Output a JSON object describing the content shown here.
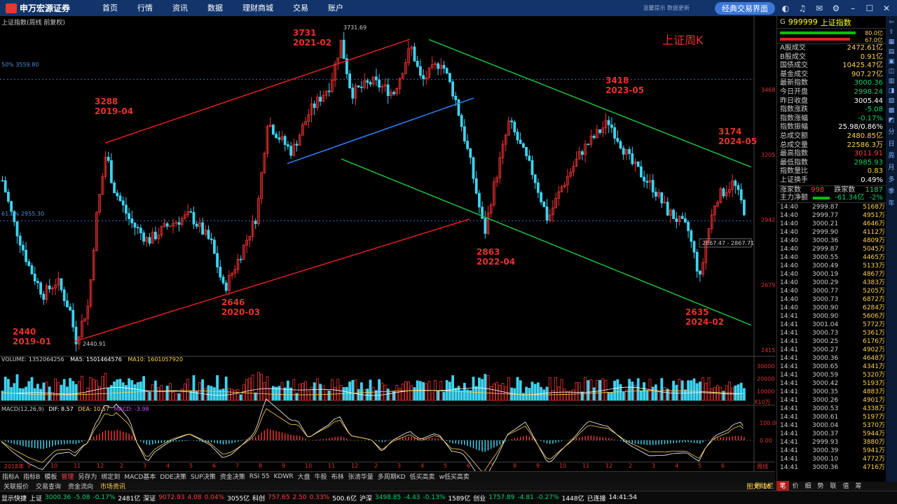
{
  "topbar": {
    "logo": "申万宏源证券",
    "nav": [
      "首页",
      "行情",
      "资讯",
      "数据",
      "理财商城",
      "交易",
      "账户"
    ],
    "faint": "温馨提示 数据更新",
    "classic_btn": "经典交易界面"
  },
  "chart": {
    "title": "上证指数(周线 前复权)",
    "big_title": "上证周K",
    "price_labels": [
      "3731.69",
      "2440.91",
      "2867.47 - 2867.71"
    ],
    "fib_labels": [
      "50% 3559.80",
      "61.8% 2955.30"
    ],
    "axis_prices": [
      "3468",
      "3205",
      "2942",
      "2679",
      "2415"
    ],
    "annotations": [
      {
        "price": "3731",
        "date": "2021-02"
      },
      {
        "price": "3288",
        "date": "2019-04"
      },
      {
        "price": "3418",
        "date": "2023-05"
      },
      {
        "price": "3174",
        "date": "2024-05"
      },
      {
        "price": "2440",
        "date": "2019-01"
      },
      {
        "price": "2646",
        "date": "2020-03"
      },
      {
        "price": "2863",
        "date": "2022-04"
      },
      {
        "price": "2635",
        "date": "2024-02"
      }
    ],
    "volume_label": "VOLUME: 1352064256",
    "ma5_label": "MA5: 1501464576",
    "ma10_label": "MA10: 1601057920",
    "vol_axis": [
      "30000",
      "20000",
      "10000",
      "X10万"
    ],
    "macd_label": "MACD(12,26,9)",
    "dif_label": "DIF: 8.57",
    "dea_label": "DEA: 10.57",
    "macd_val": "MACD: -3.98",
    "macd_axis": [
      "100.00",
      "0.00"
    ],
    "x_axis": [
      "2018年",
      "9",
      "10",
      "11",
      "12",
      "2",
      "3",
      "4",
      "5",
      "6",
      "7",
      "8",
      "9",
      "10",
      "11",
      "12",
      "2",
      "3",
      "4",
      "5",
      "6",
      "7",
      "8",
      "9",
      "10",
      "11",
      "12",
      "2",
      "3",
      "4",
      "5",
      "6",
      "周线"
    ]
  },
  "tabs": [
    "指标A",
    "指标B",
    "模板",
    "管理",
    "另存为",
    "绑定到",
    "MACD基本",
    "DDE决策",
    "SUP决策",
    "资金决策",
    "RSI 55",
    "KDWR",
    "大盘",
    "牛股",
    "布林",
    "张清华量",
    "多周期KD",
    "低买高卖",
    "w低买高卖"
  ],
  "subtabs": [
    "关联报价",
    "交易查询",
    "资金流向",
    "市场资讯"
  ],
  "subtabs_right": [
    "图文F10",
    "刷边栏"
  ],
  "rpanel": {
    "g": "G",
    "code": "999999",
    "name": "上证指数",
    "bar_top": "80.0亿",
    "bar_bot": "67.0亿",
    "stats": [
      {
        "k": "A股成交",
        "v": "2472.61亿",
        "c": "yl"
      },
      {
        "k": "B股成交",
        "v": "0.91亿",
        "c": "yl"
      },
      {
        "k": "国债成交",
        "v": "10425.47亿",
        "c": "yl"
      },
      {
        "k": "基金成交",
        "v": "907.27亿",
        "c": "yl"
      },
      {
        "k": "最新指数",
        "v": "3000.36",
        "c": "dn"
      },
      {
        "k": "今日开盘",
        "v": "2998.24",
        "c": "dn"
      },
      {
        "k": "昨日收盘",
        "v": "3005.44",
        "c": "wh"
      },
      {
        "k": "指数涨跌",
        "v": "-5.08",
        "c": "dn"
      },
      {
        "k": "指数涨幅",
        "v": "-0.17%",
        "c": "dn"
      },
      {
        "k": "指数振幅",
        "v": "25.98/0.86%",
        "c": "wh"
      },
      {
        "k": "总成交额",
        "v": "2480.85亿",
        "c": "yl"
      },
      {
        "k": "总成交量",
        "v": "22586.3万",
        "c": "yl"
      },
      {
        "k": "最高指数",
        "v": "3011.91",
        "c": "up"
      },
      {
        "k": "最低指数",
        "v": "2985.93",
        "c": "dn"
      },
      {
        "k": "指数量比",
        "v": "0.83",
        "c": "yl"
      },
      {
        "k": "上证换手",
        "v": "0.49%",
        "c": "wh"
      }
    ],
    "rise_label": "涨家数",
    "rise_val": "998",
    "fall_label": "跌家数",
    "fall_val": "1187",
    "net_label": "主力净额",
    "net_val": "-61.34亿",
    "net_pct": "-2%",
    "ticks": [
      [
        "14:40",
        "2999.87",
        "5168万"
      ],
      [
        "14:40",
        "2999.77",
        "4951万"
      ],
      [
        "14:40",
        "3000.21",
        "4646万"
      ],
      [
        "14:40",
        "2999.90",
        "4112万"
      ],
      [
        "14:40",
        "3000.36",
        "4809万"
      ],
      [
        "14:40",
        "2999.87",
        "5045万"
      ],
      [
        "14:40",
        "3000.55",
        "4465万"
      ],
      [
        "14:40",
        "3000.49",
        "5133万"
      ],
      [
        "14:40",
        "3000.19",
        "4867万"
      ],
      [
        "14:40",
        "3000.29",
        "4383万"
      ],
      [
        "14:40",
        "3000.77",
        "5205万"
      ],
      [
        "14:40",
        "3000.73",
        "6872万"
      ],
      [
        "14:40",
        "3000.90",
        "6284万"
      ],
      [
        "14:41",
        "3000.90",
        "5606万"
      ],
      [
        "14:41",
        "3001.04",
        "5772万"
      ],
      [
        "14:41",
        "3000.73",
        "5361万"
      ],
      [
        "14:41",
        "3000.25",
        "6176万"
      ],
      [
        "14:41",
        "3000.27",
        "4902万"
      ],
      [
        "14:41",
        "3000.36",
        "4648万"
      ],
      [
        "14:41",
        "3000.65",
        "4341万"
      ],
      [
        "14:41",
        "3000.59",
        "5320万"
      ],
      [
        "14:41",
        "3000.42",
        "5193万"
      ],
      [
        "14:41",
        "3000.35",
        "4883万"
      ],
      [
        "14:41",
        "3000.26",
        "4901万"
      ],
      [
        "14:41",
        "3000.53",
        "4338万"
      ],
      [
        "14:41",
        "3000.61",
        "5197万"
      ],
      [
        "14:41",
        "3000.04",
        "5370万"
      ],
      [
        "14:41",
        "3000.37",
        "5944万"
      ],
      [
        "14:41",
        "2999.93",
        "3880万"
      ],
      [
        "14:41",
        "3000.39",
        "5941万"
      ],
      [
        "14:41",
        "3000.10",
        "4772万"
      ],
      [
        "14:41",
        "3000.36",
        "4716万"
      ]
    ],
    "foot": [
      "笔",
      "价",
      "细",
      "势",
      "联",
      "值",
      "筹"
    ]
  },
  "sidebar": [
    "分",
    "日",
    "周",
    "月",
    "多",
    "季",
    "年"
  ],
  "status": [
    {
      "t": "显示快捷",
      "c": "wh"
    },
    {
      "t": "上证",
      "c": "wh"
    },
    {
      "t": "3000.36",
      "c": "dn"
    },
    {
      "t": "-5.08",
      "c": "dn"
    },
    {
      "t": "-0.17%",
      "c": "dn"
    },
    {
      "t": "2481亿",
      "c": "wh"
    },
    {
      "t": "深证",
      "c": "wh"
    },
    {
      "t": "9072.93",
      "c": "up"
    },
    {
      "t": "4.08",
      "c": "up"
    },
    {
      "t": "0.04%",
      "c": "up"
    },
    {
      "t": "3055亿",
      "c": "wh"
    },
    {
      "t": "科创",
      "c": "wh"
    },
    {
      "t": "757.65",
      "c": "up"
    },
    {
      "t": "2.50",
      "c": "up"
    },
    {
      "t": "0.33%",
      "c": "up"
    },
    {
      "t": "500.6亿",
      "c": "wh"
    },
    {
      "t": "沪深",
      "c": "wh"
    },
    {
      "t": "3498.85",
      "c": "dn"
    },
    {
      "t": "-4.43",
      "c": "dn"
    },
    {
      "t": "-0.13%",
      "c": "dn"
    },
    {
      "t": "1589亿",
      "c": "wh"
    },
    {
      "t": "创业",
      "c": "wh"
    },
    {
      "t": "1757.89",
      "c": "dn"
    },
    {
      "t": "-4.81",
      "c": "dn"
    },
    {
      "t": "-0.27%",
      "c": "dn"
    },
    {
      "t": "1448亿",
      "c": "wh"
    },
    {
      "t": "已连接",
      "c": "wh"
    },
    {
      "t": "14:41:54",
      "c": "wh"
    }
  ]
}
